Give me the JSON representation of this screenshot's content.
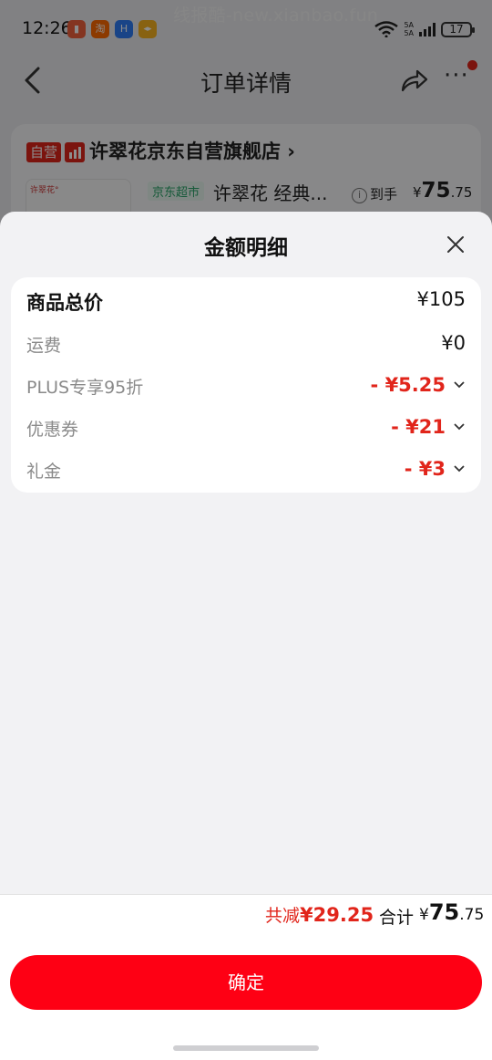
{
  "status_bar": {
    "time": "12:26",
    "apps": [
      {
        "name": "video-app-icon",
        "color": "#f0623d",
        "glyph": "▮"
      },
      {
        "name": "taobao-app-icon",
        "color": "#ff6a00",
        "glyph": "淘"
      },
      {
        "name": "blue-app-icon",
        "color": "#2f7cf6",
        "glyph": "H"
      },
      {
        "name": "orange-app-icon",
        "color": "#f7b31f",
        "glyph": "◂▸"
      }
    ],
    "network_top": "5A",
    "network_bottom": "5A",
    "battery": "17"
  },
  "watermark": "线报酷-new.xianbao.fun",
  "nav": {
    "title": "订单详情"
  },
  "shop": {
    "self_tag": "自营",
    "name": "许翠花京东自营旗舰店 ›",
    "product_brand": "许翠花°",
    "store_tag": "京东超市",
    "product_name": "许翠花 经典...",
    "arrive_label": "到手",
    "arrive_currency": "¥",
    "arrive_int": "75",
    "arrive_dec": ".75"
  },
  "sheet": {
    "title": "金额明细",
    "rows": [
      {
        "label": "商品总价",
        "value": "¥105"
      },
      {
        "label": "运费",
        "value": "¥0"
      },
      {
        "label": "PLUS专享95折",
        "value": "- ¥5.25"
      },
      {
        "label": "优惠券",
        "value": "- ¥21"
      },
      {
        "label": "礼金",
        "value": "- ¥3"
      }
    ],
    "reduce_label": "共减",
    "reduce_value": "¥29.25",
    "total_label": "合计",
    "total_currency": "¥",
    "total_int": "75",
    "total_dec": ".75",
    "confirm_label": "确定"
  },
  "colors": {
    "accent": "#e1251b",
    "button": "#fe0014"
  }
}
